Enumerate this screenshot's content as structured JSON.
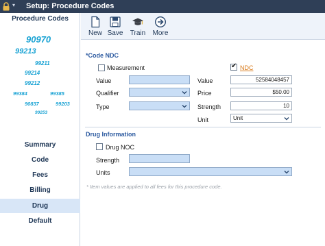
{
  "titlebar": {
    "title": "Setup: Procedure Codes",
    "menu_glyph": "▾"
  },
  "sidebar": {
    "heading": "Procedure Codes",
    "cloud_codes": [
      "90970",
      "99213",
      "99211",
      "99214",
      "99212",
      "99384",
      "99385",
      "90837",
      "99203",
      "99253"
    ],
    "nav_items": [
      "Summary",
      "Code",
      "Fees",
      "Billing",
      "Drug",
      "Default"
    ],
    "active_item": "Drug"
  },
  "toolbar": {
    "buttons": [
      {
        "label": "New",
        "icon": "new-document-icon"
      },
      {
        "label": "Save",
        "icon": "save-disk-icon"
      },
      {
        "label": "Train",
        "icon": "graduation-cap-icon"
      },
      {
        "label": "More",
        "icon": "arrow-circle-icon"
      }
    ]
  },
  "code_ndc": {
    "section_title": "*Code NDC",
    "measurement": {
      "label": "Measurement",
      "checked": false,
      "value_label": "Value",
      "value": "",
      "qualifier_label": "Qualifier",
      "qualifier": "",
      "type_label": "Type",
      "type": ""
    },
    "ndc": {
      "label": "NDC",
      "checked": true,
      "value_label": "Value",
      "value": "52584048457",
      "price_label": "Price",
      "price": "$50.00",
      "strength_label": "Strength",
      "strength": "10",
      "unit_label": "Unit",
      "unit": "Unit"
    }
  },
  "drug_info": {
    "section_title": "Drug Information",
    "drug_noc": {
      "label": "Drug NOC",
      "checked": false
    },
    "strength_label": "Strength",
    "strength": "",
    "units_label": "Units",
    "units": ""
  },
  "note": "* Item values are applied to all fees for this procedure code.",
  "colors": {
    "titlebar": "#2f3f57",
    "accent": "#2c5aa0",
    "field_blue": "#c9def6",
    "cloud": "#1aa3d4",
    "link": "#d97a1a"
  }
}
